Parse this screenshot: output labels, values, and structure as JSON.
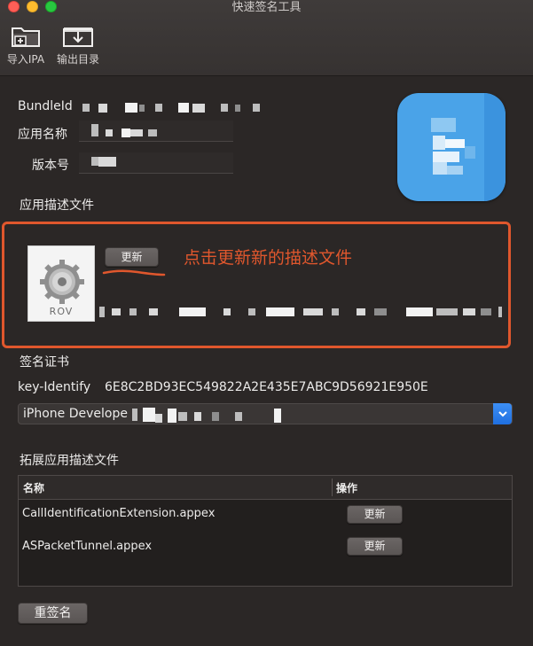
{
  "window": {
    "title": "快速签名工具"
  },
  "toolbar": {
    "import_label": "导入IPA",
    "export_label": "输出目录"
  },
  "form": {
    "bundle_id_label": "BundleId",
    "app_name_label": "应用名称",
    "version_label": "版本号"
  },
  "profile": {
    "section_title": "应用描述文件",
    "thumbnail_text": "ROV",
    "update_button": "更新",
    "annotation": "点击更新新的描述文件"
  },
  "certificate": {
    "section_title": "签名证书",
    "key_label": "key-Identify",
    "key_value": "6E8C2BD93EC549822A2E435E7ABC9D56921E950E",
    "selected": "iPhone Develope"
  },
  "extensions": {
    "section_title": "拓展应用描述文件",
    "columns": [
      "名称",
      "操作"
    ],
    "rows": [
      {
        "name": "CallIdentificationExtension.appex",
        "action": "更新"
      },
      {
        "name": "ASPacketTunnel.appex",
        "action": "更新"
      }
    ]
  },
  "actions": {
    "resign_button": "重签名"
  },
  "colors": {
    "accent": "#e0572d",
    "select_blue": "#1f6fe0",
    "icon_blue": "#4aa3e8"
  }
}
